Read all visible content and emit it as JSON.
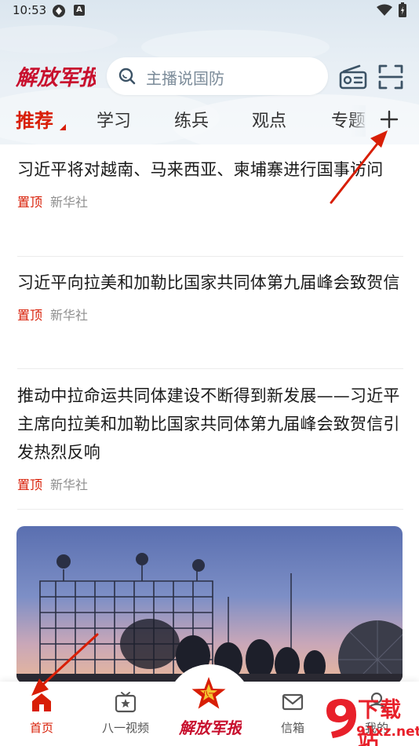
{
  "status_bar": {
    "time": "10:53",
    "notif_badge": "A"
  },
  "header": {
    "logo_text": "解放军报",
    "search": {
      "placeholder": "主播说国防"
    }
  },
  "tabs": [
    {
      "label": "推荐",
      "active": true
    },
    {
      "label": "学习"
    },
    {
      "label": "练兵"
    },
    {
      "label": "观点"
    },
    {
      "label": "专题"
    }
  ],
  "news": [
    {
      "title": "习近平将对越南、马来西亚、柬埔寨进行国事访问",
      "pinned": "置顶",
      "source": "新华社"
    },
    {
      "title": "习近平向拉美和加勒比国家共同体第九届峰会致贺信",
      "pinned": "置顶",
      "source": "新华社"
    },
    {
      "title": "推动中拉命运共同体建设不断得到新发展——习近平主席向拉美和加勒比国家共同体第九届峰会致贺信引发热烈反响",
      "pinned": "置顶",
      "source": "新华社"
    }
  ],
  "bottom_nav": [
    {
      "label": "首页",
      "icon": "home-icon",
      "active": true
    },
    {
      "label": "八一视频",
      "icon": "tv-icon"
    },
    {
      "label": "解放军报",
      "icon": "army-star-icon"
    },
    {
      "label": "信箱",
      "icon": "mail-icon"
    },
    {
      "label": "我的",
      "icon": "user-icon"
    }
  ],
  "watermark": {
    "title": "下载站",
    "url": "91xz.net"
  },
  "colors": {
    "accent": "#d81e06",
    "text": "#1a1a1a",
    "meta": "#8e8e8e"
  }
}
